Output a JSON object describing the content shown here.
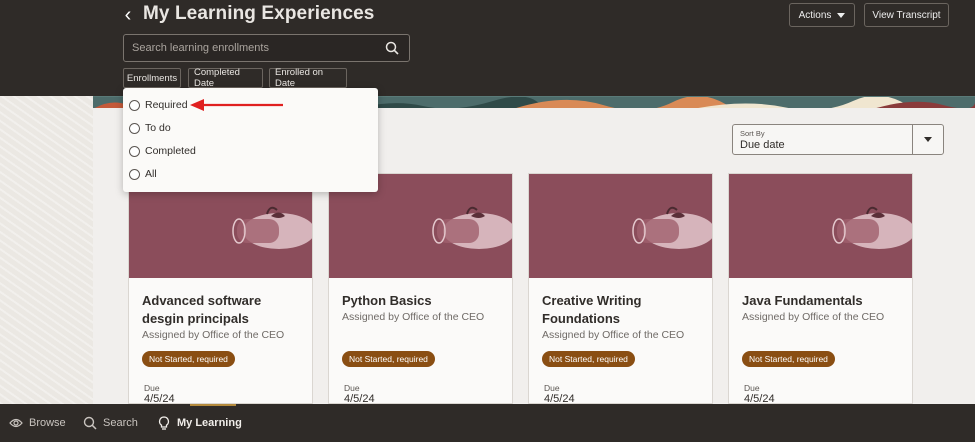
{
  "header": {
    "title": "My Learning Experiences",
    "actions_label": "Actions",
    "transcript_label": "View Transcript"
  },
  "search": {
    "placeholder": "Search learning enrollments"
  },
  "filters": [
    "Enrollments",
    "Completed Date",
    "Enrolled on Date"
  ],
  "dropdown": {
    "options": [
      "Required",
      "To do",
      "Completed",
      "All"
    ]
  },
  "sort": {
    "label": "Sort By",
    "value": "Due date"
  },
  "cards": [
    {
      "title": "Advanced software desgin principals",
      "assigned": "Assigned by Office of the CEO",
      "status": "Not Started, required",
      "due_label": "Due",
      "due": "4/5/24"
    },
    {
      "title": "Python Basics",
      "assigned": "Assigned by Office of the CEO",
      "status": "Not Started, required",
      "due_label": "Due",
      "due": "4/5/24"
    },
    {
      "title": "Creative Writing Foundations",
      "assigned": "Assigned by Office of the CEO",
      "status": "Not Started, required",
      "due_label": "Due",
      "due": "4/5/24"
    },
    {
      "title": "Java Fundamentals",
      "assigned": "Assigned by Office of the CEO",
      "status": "Not Started, required",
      "due_label": "Due",
      "due": "4/5/24"
    }
  ],
  "bottom_nav": {
    "browse": "Browse",
    "search": "Search",
    "my_learning": "My Learning"
  },
  "colors": {
    "header_bg": "#2f2b28",
    "card_image": "#8b4d5b",
    "badge": "#8a4e13",
    "arrow": "#e02020"
  }
}
